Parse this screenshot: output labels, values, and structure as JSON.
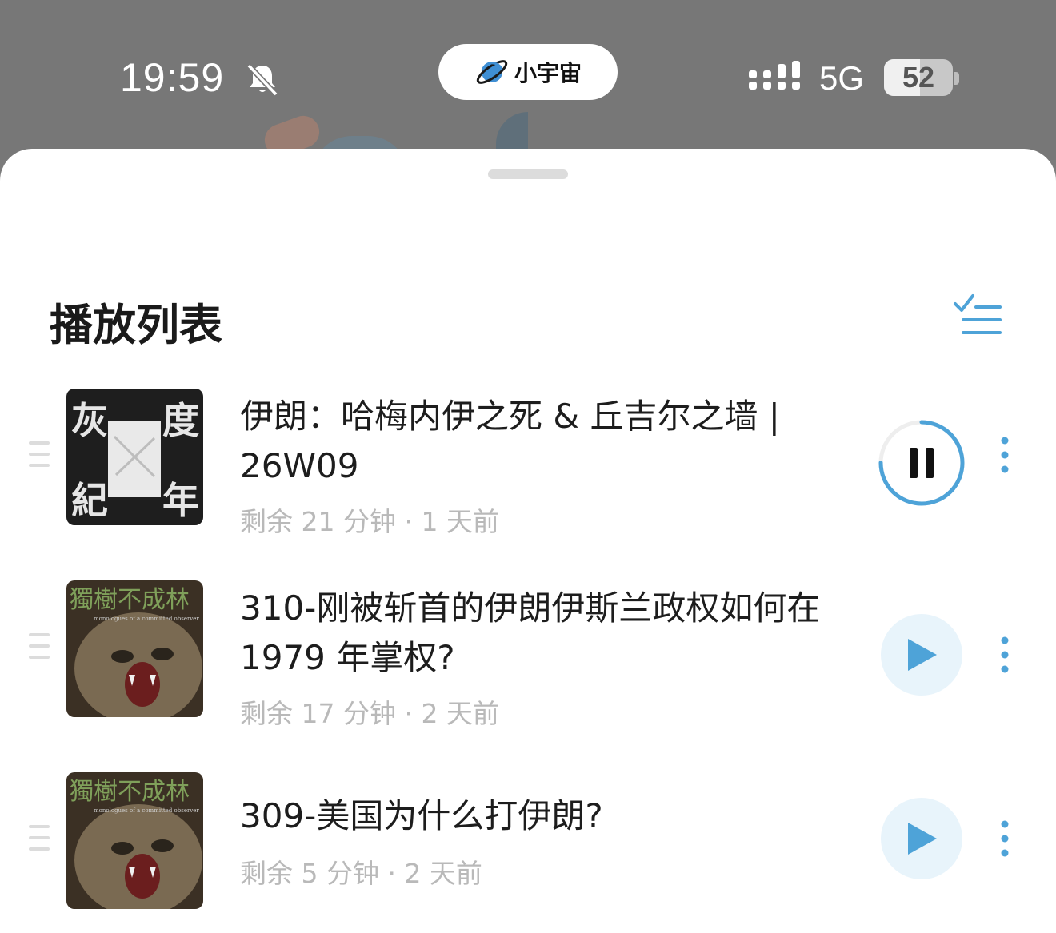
{
  "status_bar": {
    "time": "19:59",
    "network": "5G",
    "battery": "52",
    "battery_fraction": 0.52
  },
  "app_pill": {
    "label": "小宇宙"
  },
  "sheet": {
    "title": "播放列表"
  },
  "colors": {
    "accent": "#4ea3d8",
    "accent_bg": "#e8f4fb",
    "meta_text": "#b9b9b9"
  },
  "episodes": [
    {
      "title": "伊朗：哈梅内伊之死 & 丘吉尔之墙 | 26W09",
      "meta": "剩余 21 分钟 · 1 天前",
      "state": "playing",
      "progress": 0.75,
      "cover": {
        "chars": [
          "灰",
          "度",
          "紀",
          "年"
        ]
      }
    },
    {
      "title": "310-刚被斩首的伊朗伊斯兰政权如何在 1979 年掌权?",
      "meta": "剩余 17 分钟 · 2 天前",
      "state": "paused",
      "cover": {
        "text": "獨樹不成林",
        "subtext": "monologues of a committed observer"
      }
    },
    {
      "title": "309-美国为什么打伊朗?",
      "meta": "剩余 5 分钟 · 2 天前",
      "state": "paused",
      "cover": {
        "text": "獨樹不成林",
        "subtext": "monologues of a committed observer"
      }
    }
  ]
}
